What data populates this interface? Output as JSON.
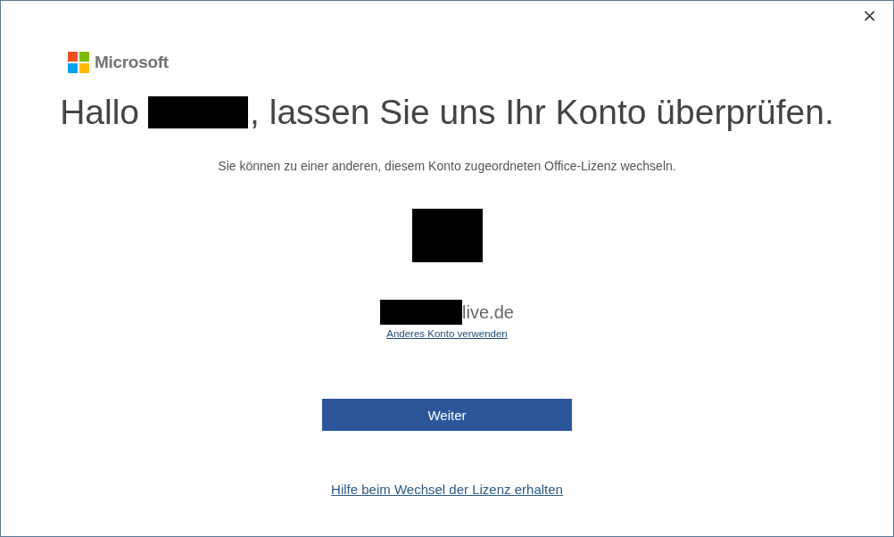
{
  "window": {
    "close": "×"
  },
  "logo": {
    "text": "Microsoft"
  },
  "heading": {
    "before": "Hallo",
    "after": ", lassen Sie uns Ihr Konto überprüfen."
  },
  "subtitle": "Sie können zu einer anderen, diesem Konto zugeordneten Office-Lizenz wechseln.",
  "account": {
    "email_suffix": "live.de",
    "switch_link": "Anderes Konto verwenden"
  },
  "primary_button": "Weiter",
  "help_link": "Hilfe beim Wechsel der Lizenz erhalten"
}
